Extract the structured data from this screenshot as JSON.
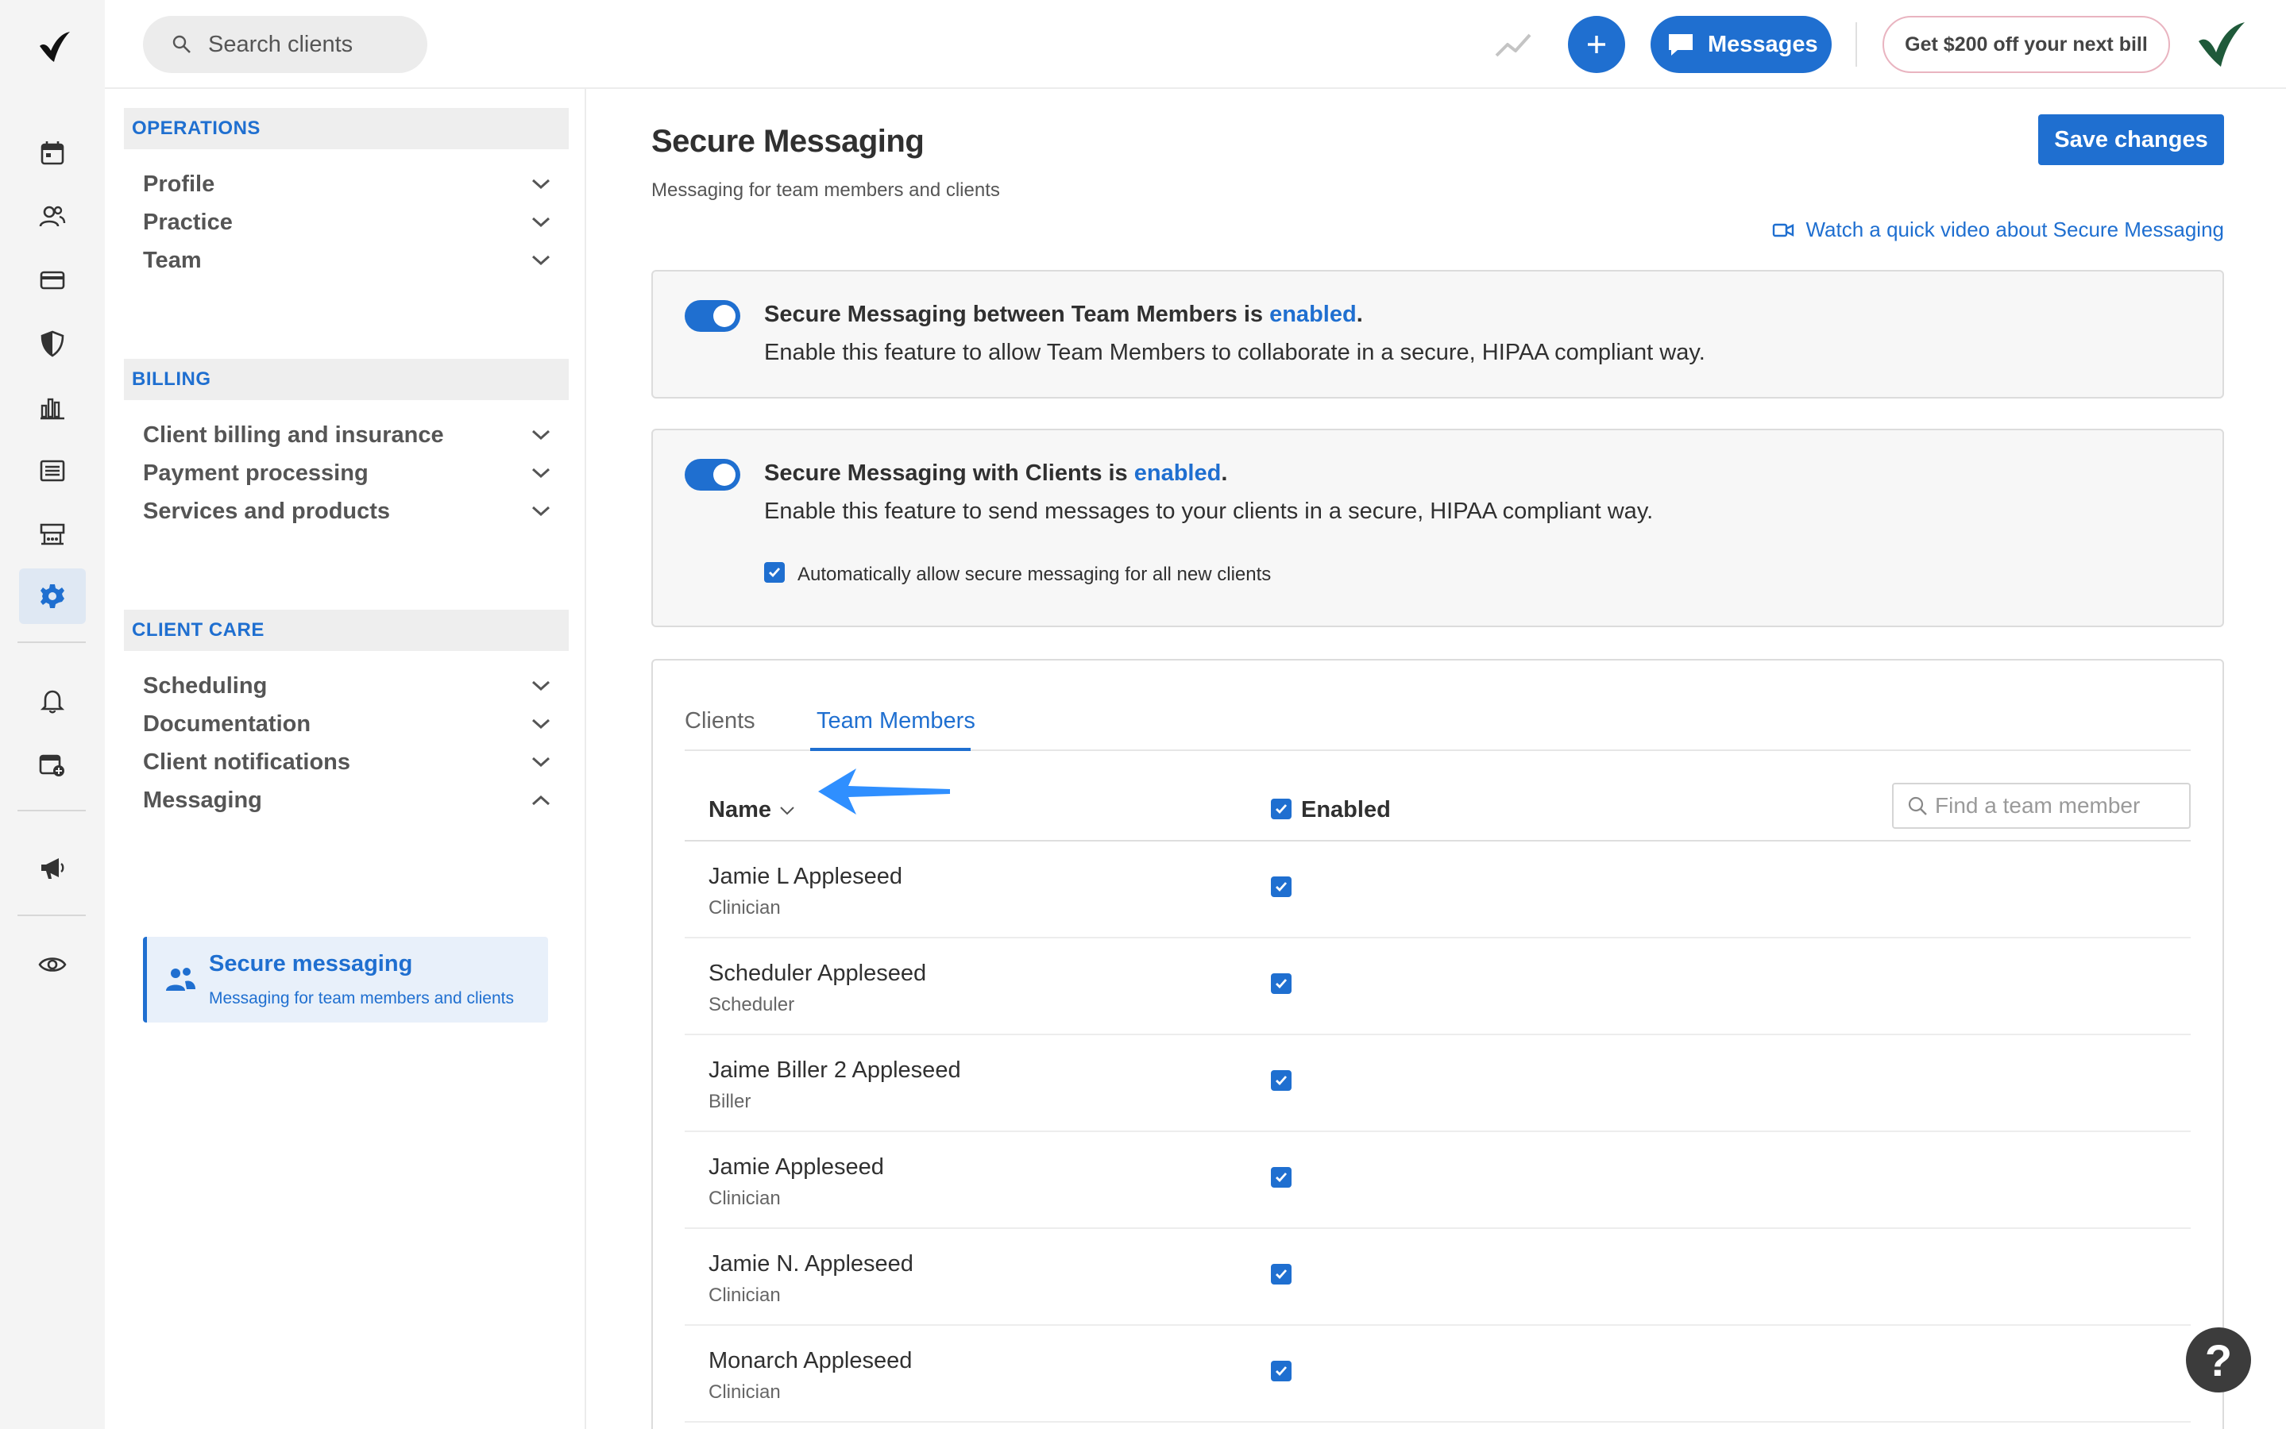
{
  "topbar": {
    "search_placeholder": "Search clients",
    "messages_label": "Messages",
    "promo_label": "Get $200 off your next bill"
  },
  "rail": {
    "icons": [
      "calendar-icon",
      "clients-icon",
      "billing-card-icon",
      "insurance-shield-icon",
      "analytics-icon",
      "list-icon",
      "marketplace-icon",
      "settings-gear-icon",
      "notifications-bell-icon",
      "calendar-add-icon",
      "announcements-megaphone-icon",
      "preview-eye-icon"
    ],
    "active": "settings-gear-icon"
  },
  "nav": {
    "operations_header": "OPERATIONS",
    "profile": "Profile",
    "practice": "Practice",
    "team": "Team",
    "billing_header": "BILLING",
    "client_billing": "Client billing and insurance",
    "payment_processing": "Payment processing",
    "services_products": "Services and products",
    "client_care_header": "CLIENT CARE",
    "scheduling": "Scheduling",
    "documentation": "Documentation",
    "client_notifications": "Client notifications",
    "messaging": "Messaging",
    "secure_messaging_title": "Secure messaging",
    "secure_messaging_desc": "Messaging for team members and clients"
  },
  "page": {
    "title": "Secure Messaging",
    "subtitle": "Messaging for team members and clients",
    "save_label": "Save changes",
    "video_link": "Watch a quick video about Secure Messaging"
  },
  "team_card": {
    "title_prefix": "Secure Messaging between Team Members is ",
    "status": "enabled",
    "dot": ".",
    "description": "Enable this feature to allow Team Members to collaborate in a secure, HIPAA compliant way.",
    "toggle_on": true
  },
  "clients_card": {
    "title_prefix": "Secure Messaging with Clients is ",
    "status": "enabled",
    "dot": ".",
    "description": "Enable this feature to send messages to your clients in a secure, HIPAA compliant way.",
    "auto_allow_label": "Automatically allow secure messaging for all new clients",
    "auto_allow_checked": true,
    "toggle_on": true
  },
  "table": {
    "tabs": [
      "Clients",
      "Team Members"
    ],
    "active_tab": "Team Members",
    "col_name": "Name",
    "col_enabled": "Enabled",
    "find_placeholder": "Find a team member",
    "rows": [
      {
        "name": "Jamie L Appleseed",
        "role": "Clinician",
        "enabled": true
      },
      {
        "name": "Scheduler Appleseed",
        "role": "Scheduler",
        "enabled": true
      },
      {
        "name": "Jaime Biller 2 Appleseed",
        "role": "Biller",
        "enabled": true
      },
      {
        "name": "Jamie Appleseed",
        "role": "Clinician",
        "enabled": true
      },
      {
        "name": "Jamie N. Appleseed",
        "role": "Clinician",
        "enabled": true
      },
      {
        "name": "Monarch Appleseed",
        "role": "Clinician",
        "enabled": true
      }
    ]
  },
  "help_label": "?",
  "colors": {
    "accent": "#1f6fd0",
    "arrow": "#2f8fff",
    "brand_green": "#1f5a3a"
  }
}
